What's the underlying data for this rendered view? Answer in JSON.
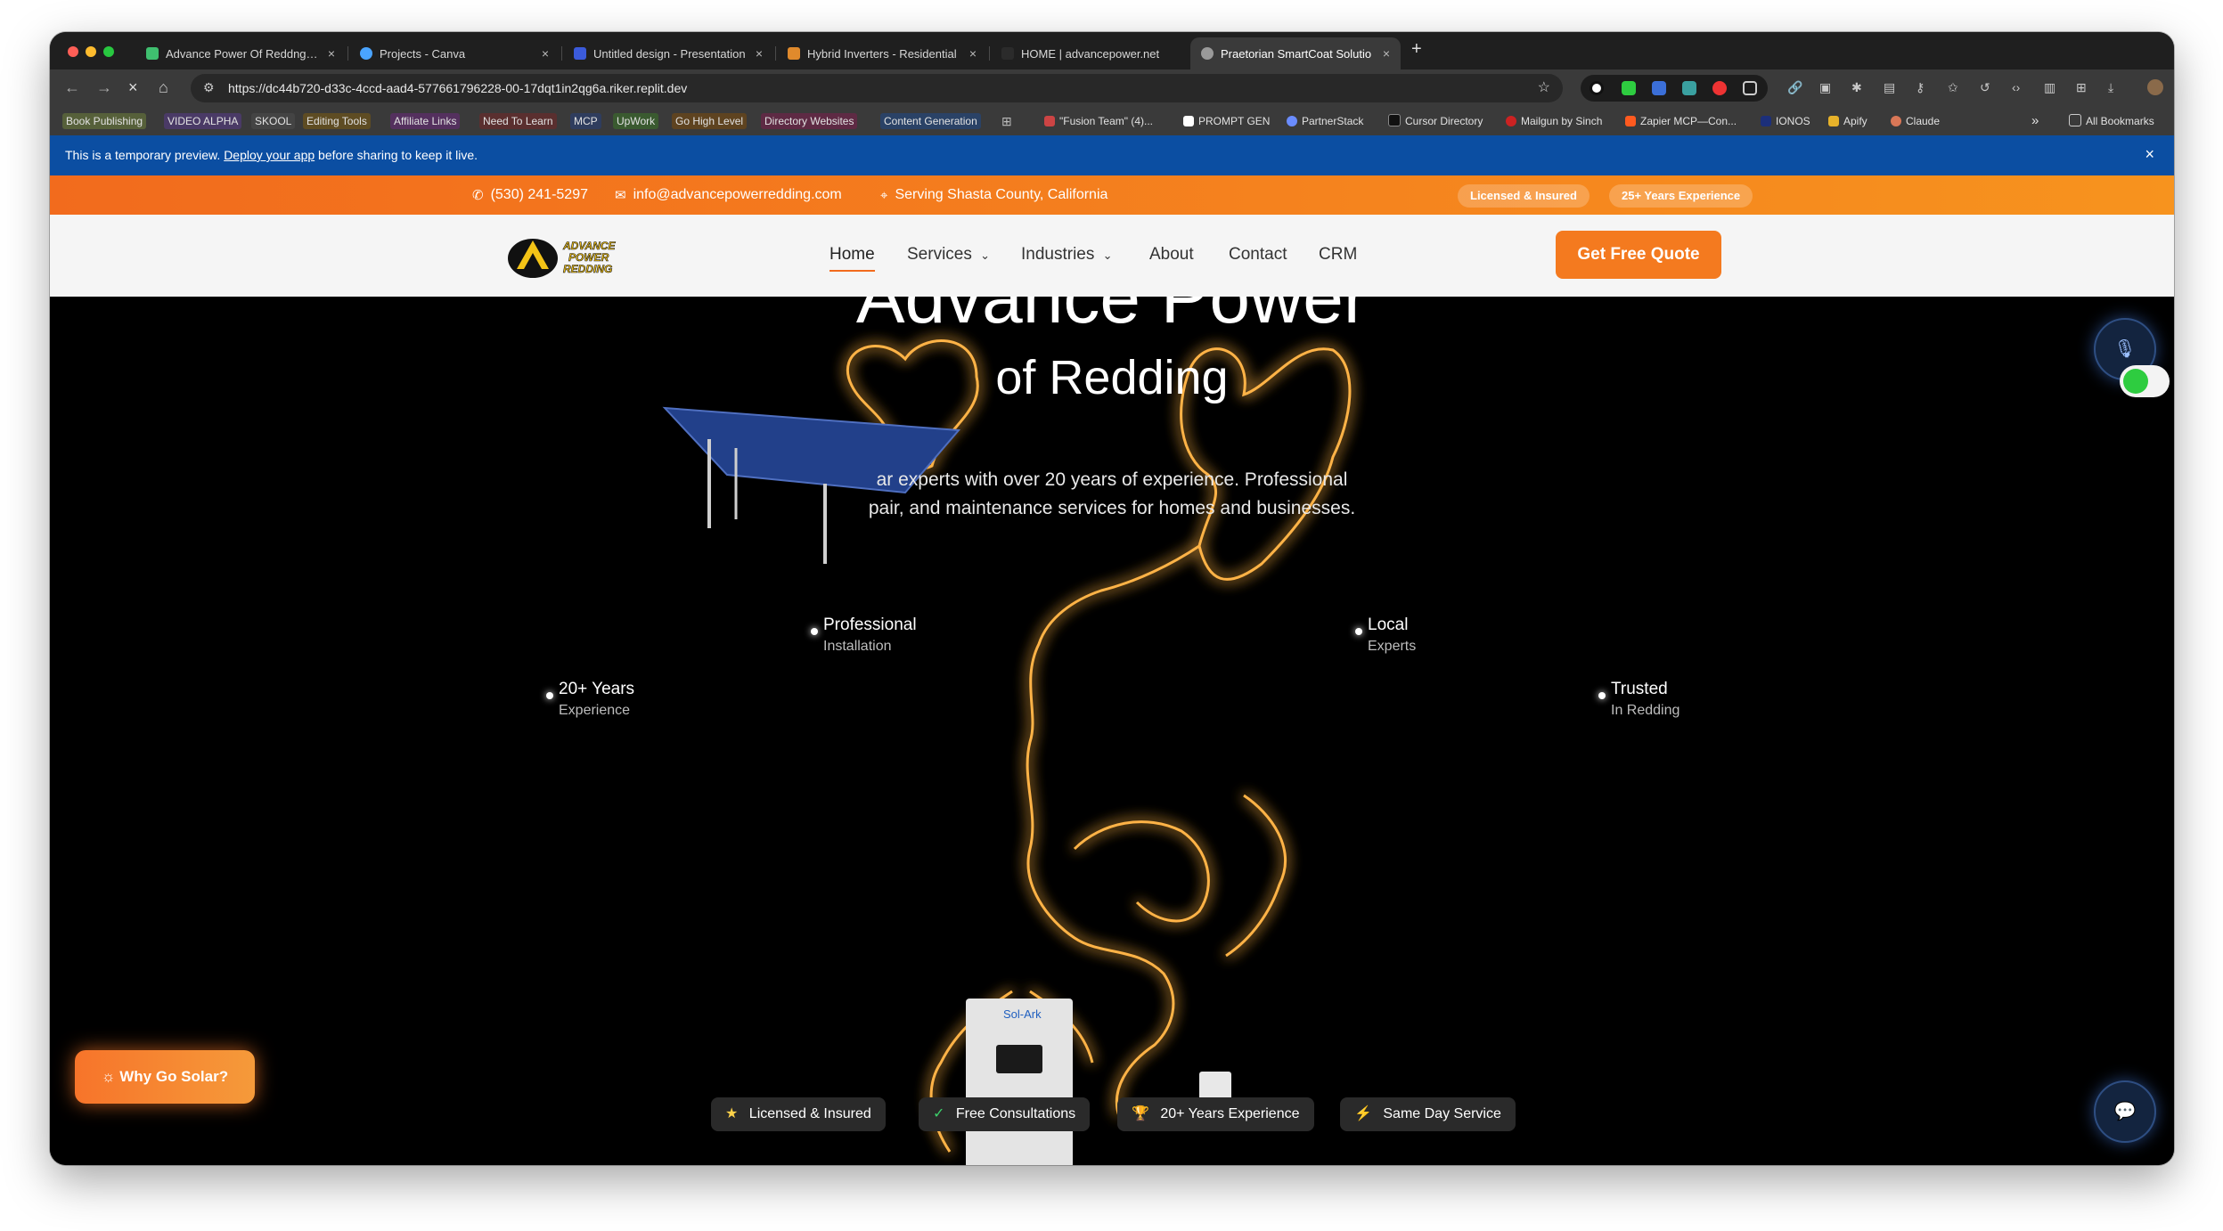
{
  "browser": {
    "tabs": [
      {
        "title": "Advance Power Of Reddng | P",
        "icon_color": "#3fbf6f"
      },
      {
        "title": "Projects - Canva",
        "icon_color": "#4aa4ff"
      },
      {
        "title": "Untitled design - Presentation",
        "icon_color": "#3b5bdb"
      },
      {
        "title": "Hybrid Inverters - Residential",
        "icon_color": "#e08a2c"
      },
      {
        "title": "HOME | advancepower.net",
        "icon_color": "#2b2b2b"
      },
      {
        "title": "Praetorian SmartCoat Solutio",
        "icon_color": "#9a9a9a"
      }
    ],
    "close_glyph": "×",
    "new_tab": "+",
    "url": "https://dc44b720-d33c-4ccd-aad4-577661796228-00-17dqt1in2qg6a.riker.replit.dev",
    "bookmarks": [
      {
        "label": "Book Publishing",
        "color": "#b8c776"
      },
      {
        "label": "VIDEO ALPHA",
        "color": "#9d6bd6"
      },
      {
        "label": "SKOOL",
        "color": "#7a7a7a"
      },
      {
        "label": "Editing Tools",
        "color": "#d6b25b"
      },
      {
        "label": "Affiliate Links",
        "color": "#b75fd0"
      },
      {
        "label": "Need To Learn",
        "color": "#b05a5a"
      },
      {
        "label": "MCP",
        "color": "#4d6fb8"
      },
      {
        "label": "UpWork",
        "color": "#6da35b"
      },
      {
        "label": "Go High Level",
        "color": "#c9893c"
      },
      {
        "label": "Directory Websites",
        "color": "#c85a8a"
      },
      {
        "label": "Content Generation",
        "color": "#4f7fc9"
      },
      {
        "label": "\"Fusion Team\" (4)...",
        "color": null
      },
      {
        "label": "PROMPT GEN",
        "color": null
      },
      {
        "label": "PartnerStack",
        "color": null
      },
      {
        "label": "Cursor Directory",
        "color": null
      },
      {
        "label": "Mailgun by Sinch",
        "color": null
      },
      {
        "label": "Zapier MCP—Con...",
        "color": null
      },
      {
        "label": "IONOS",
        "color": null
      },
      {
        "label": "Apify",
        "color": null
      },
      {
        "label": "Claude",
        "color": null
      }
    ],
    "bookmarks_overflow": "»",
    "all_bookmarks": "All Bookmarks"
  },
  "preview_banner": {
    "text_before": "This is a temporary preview.",
    "link": "Deploy your app",
    "text_after": "before sharing to keep it live.",
    "close": "×"
  },
  "topbar": {
    "phone": "(530) 241-5297",
    "email": "info@advancepowerredding.com",
    "location": "Serving Shasta County, California",
    "badges": [
      "Licensed & Insured",
      "25+ Years Experience"
    ]
  },
  "nav": {
    "logo_text": [
      "ADVANCE",
      "POWER",
      "REDDING"
    ],
    "links": [
      "Home",
      "Services",
      "Industries",
      "About",
      "Contact",
      "CRM"
    ],
    "cta": "Get Free Quote"
  },
  "hero": {
    "title_line1": "Advance Power",
    "title_line2": "of Redding",
    "desc_line1": "ar experts with over 20 years of experience. Professional",
    "desc_line2": "pair, and maintenance services for homes and businesses.",
    "stats": [
      {
        "title": "Professional",
        "sub": "Installation"
      },
      {
        "title": "Local",
        "sub": "Experts"
      },
      {
        "title": "20+ Years",
        "sub": "Experience"
      },
      {
        "title": "Trusted",
        "sub": "In Redding"
      }
    ],
    "why_button": "Why Go Solar?",
    "badges": [
      {
        "icon": "★",
        "label": "Licensed & Insured"
      },
      {
        "icon": "✓",
        "label": "Free Consultations"
      },
      {
        "icon": "🏆",
        "label": "20+ Years Experience"
      },
      {
        "icon": "⚡",
        "label": "Same Day Service"
      }
    ],
    "inverter_brand": "Sol-Ark"
  },
  "colors": {
    "accent": "#f47a1f",
    "preview_banner": "#0b4ea2",
    "lightning": "#ffb347"
  }
}
